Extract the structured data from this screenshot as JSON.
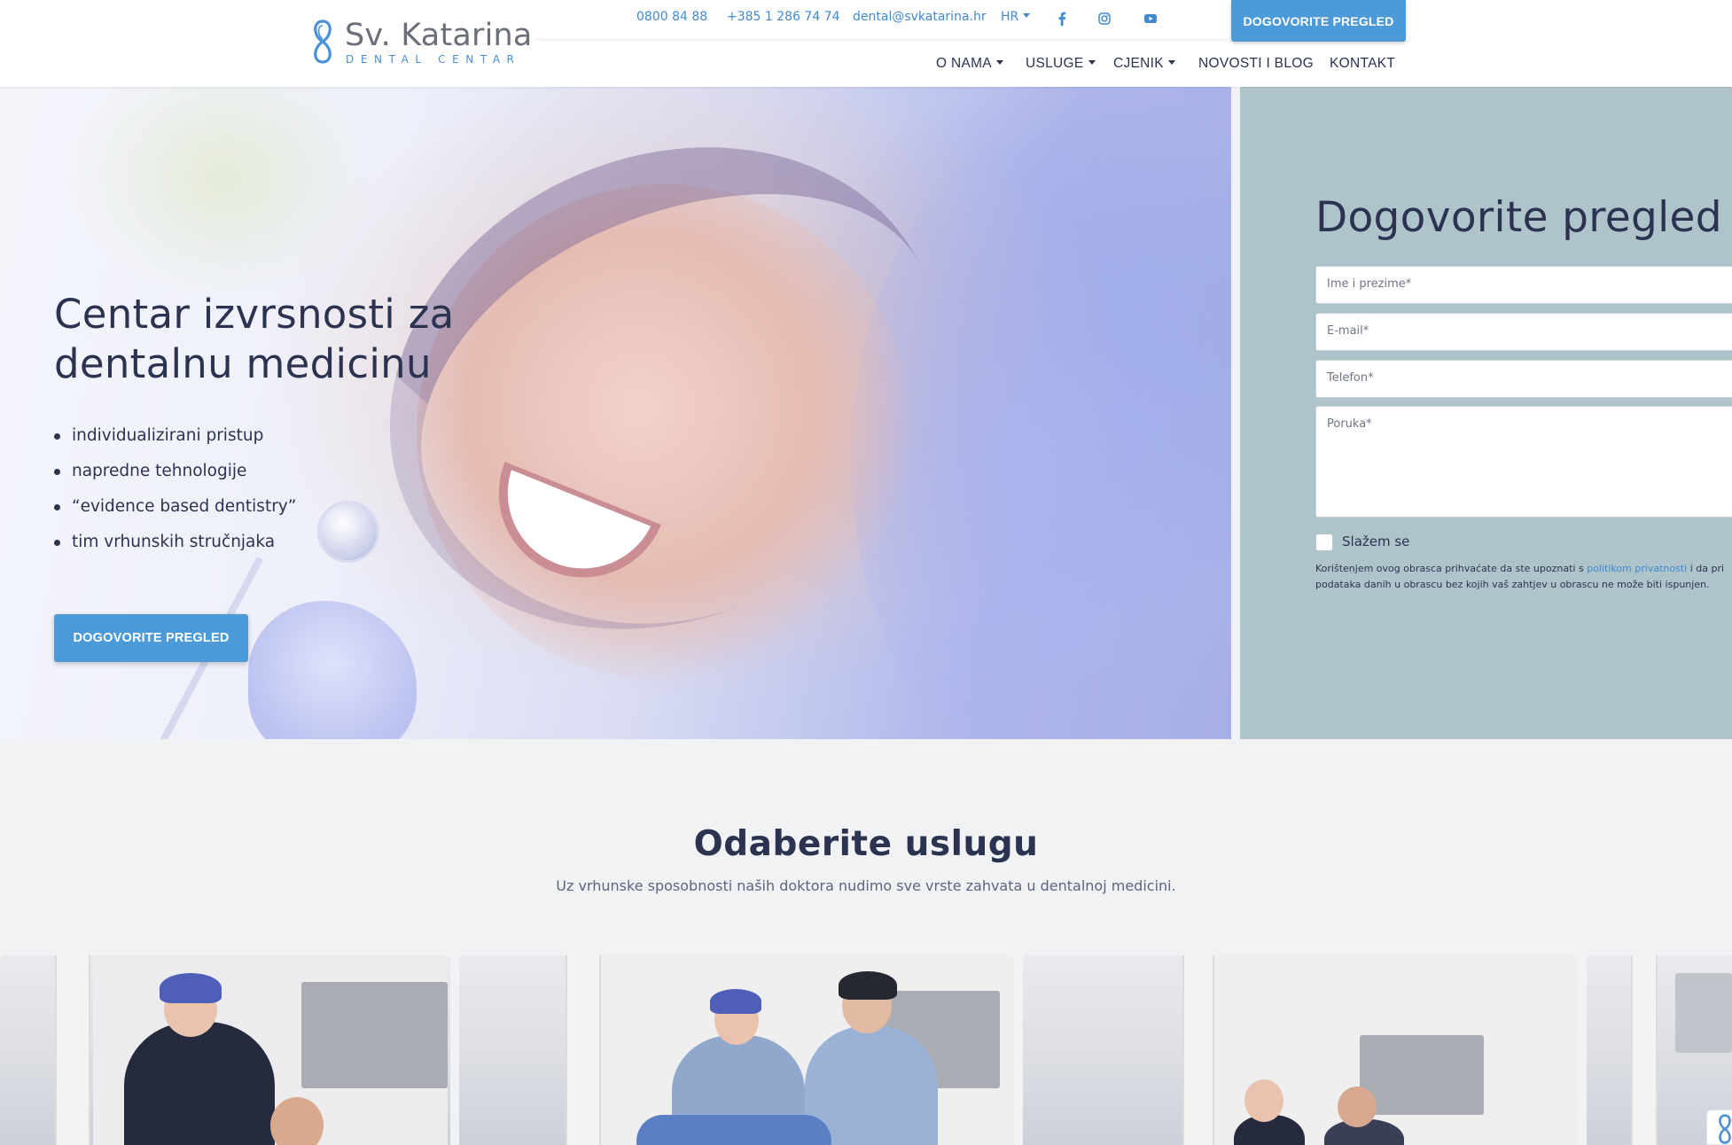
{
  "brand": {
    "name": "Sv. Katarina",
    "tagline": "DENTAL CENTAR",
    "accent": "#4d9ad9",
    "text_dark": "#2b3350",
    "panel_bg": "#afc4ca"
  },
  "topbar": {
    "phone1": "0800 84 88",
    "phone2": "+385 1 286 74 74",
    "email": "dental@svkatarina.hr",
    "language": "HR",
    "social_icons": [
      "facebook-icon",
      "instagram-icon",
      "youtube-icon"
    ],
    "cta": "DOGOVORITE PREGLED"
  },
  "nav": {
    "items": [
      {
        "label": "O NAMA",
        "dropdown": true
      },
      {
        "label": "USLUGE",
        "dropdown": true
      },
      {
        "label": "CJENIK",
        "dropdown": true
      },
      {
        "label": "NOVOSTI I BLOG",
        "dropdown": false
      },
      {
        "label": "KONTAKT",
        "dropdown": false
      }
    ]
  },
  "hero": {
    "title_line1": "Centar izvrsnosti za",
    "title_line2": "dentalnu medicinu",
    "bullets": [
      "individualizirani pristup",
      "napredne tehnologije",
      "“evidence based dentistry”",
      "tim vrhunskih stručnjaka"
    ],
    "cta": "DOGOVORITE PREGLED"
  },
  "form": {
    "title": "Dogovorite pregled",
    "name_placeholder": "Ime i prezime*",
    "email_placeholder": "E-mail*",
    "phone_placeholder": "Telefon*",
    "message_placeholder": "Poruka*",
    "consent_label": "Slažem se",
    "legal_before": "Korištenjem ovog obrasca prihvaćate da ste upoznati s ",
    "legal_link": "politikom privatnosti",
    "legal_after": " i da pri",
    "legal_line2": "podataka danih u obrascu bez kojih vaš zahtjev u obrascu ne može biti ispunjen."
  },
  "services": {
    "title": "Odaberite uslugu",
    "subtitle": "Uz vrhunske sposobnosti naših doktora nudimo sve vrste zahvata u dentalnoj medicini."
  }
}
